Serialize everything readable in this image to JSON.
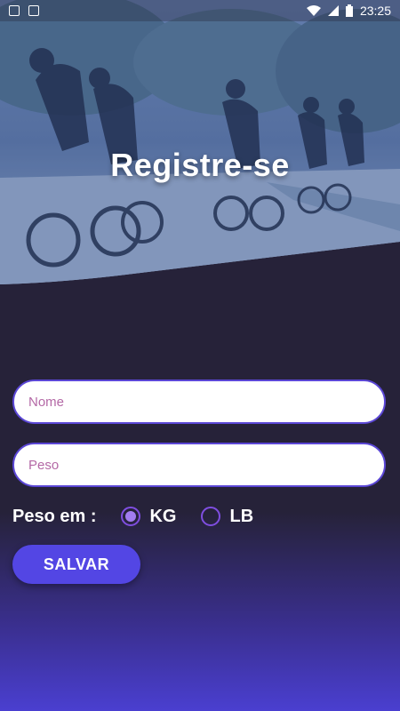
{
  "status_bar": {
    "time": "23:25",
    "icons": [
      "image-icon",
      "app-icon",
      "wifi-icon",
      "signal-icon",
      "battery-icon"
    ]
  },
  "header": {
    "title": "Registre-se",
    "image": "cyclists-photo"
  },
  "form": {
    "name_placeholder": "Nome",
    "weight_placeholder": "Peso",
    "weight_unit_label": "Peso em :",
    "units": [
      "KG",
      "LB"
    ],
    "selected_unit": "KG",
    "save_label": "SALVAR"
  },
  "colors": {
    "background": "#262239",
    "accent": "#5346e4",
    "field_border": "#5b47d6",
    "placeholder": "#b469a6",
    "radio": "#7f4ee0"
  }
}
